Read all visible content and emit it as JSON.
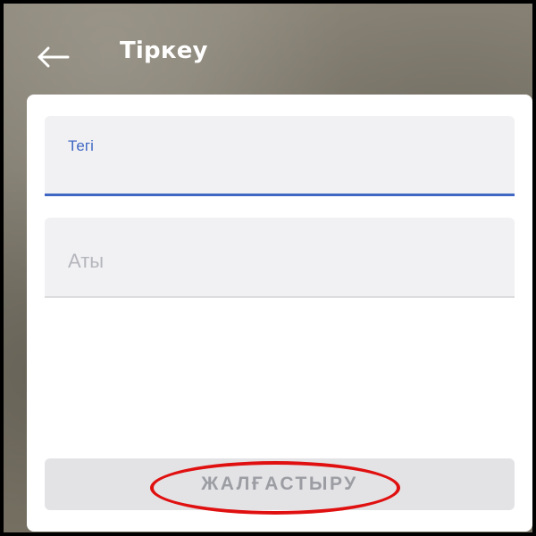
{
  "appbar": {
    "title": "Тіркеу",
    "back_icon": "arrow-left-icon"
  },
  "form": {
    "surname": {
      "label": "Тегі",
      "value": ""
    },
    "name": {
      "placeholder": "Аты",
      "value": ""
    },
    "continue_label": "ЖАЛҒАСТЫРУ"
  },
  "annotation": {
    "highlight_color": "#e01010"
  },
  "colors": {
    "accent": "#3f67c3",
    "title_text": "#ffffff",
    "field_bg": "#f1f1f3",
    "button_bg": "#e3e3e6",
    "button_text": "#9b9da3"
  }
}
